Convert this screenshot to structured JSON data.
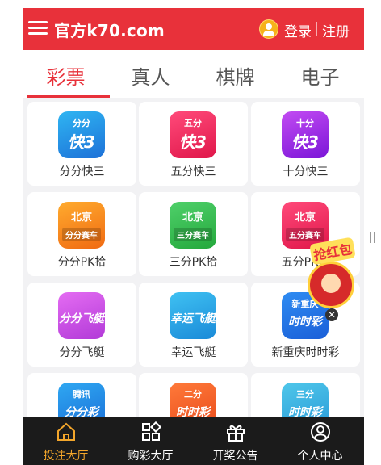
{
  "header": {
    "title": "官方k70.com",
    "login": "登录",
    "separator": "|",
    "register": "注册",
    "bg_color": "#e8313a"
  },
  "tabs": [
    {
      "label": "彩票",
      "active": true
    },
    {
      "label": "真人",
      "active": false
    },
    {
      "label": "棋牌",
      "active": false
    },
    {
      "label": "电子",
      "active": false
    }
  ],
  "games": [
    {
      "label": "分分快三",
      "icon_line1": "分分",
      "icon_line2": "快3",
      "color1": "#2fb5f2",
      "color2": "#1d71d8"
    },
    {
      "label": "五分快三",
      "icon_line1": "五分",
      "icon_line2": "快3",
      "color1": "#ff4a7a",
      "color2": "#e0174a"
    },
    {
      "label": "十分快三",
      "icon_line1": "十分",
      "icon_line2": "快3",
      "color1": "#c24bf2",
      "color2": "#7b16d8"
    },
    {
      "label": "分分PK拾",
      "icon_line1": "北京",
      "icon_line2": "分分赛车",
      "color1": "#ffab2e",
      "color2": "#f06a12"
    },
    {
      "label": "三分PK拾",
      "icon_line1": "北京",
      "icon_line2": "三分赛车",
      "color1": "#4fd06a",
      "color2": "#24a83c"
    },
    {
      "label": "五分PK拾",
      "icon_line1": "北京",
      "icon_line2": "五分赛车",
      "color1": "#ff4a7a",
      "color2": "#e0174a"
    },
    {
      "label": "分分飞艇",
      "icon_line1": "",
      "icon_line2": "分分飞艇",
      "color1": "#e46cf2",
      "color2": "#b23ad8"
    },
    {
      "label": "幸运飞艇",
      "icon_line1": "",
      "icon_line2": "幸运飞艇",
      "color1": "#3fc1f2",
      "color2": "#1a8ad8"
    },
    {
      "label": "新重庆时时彩",
      "icon_line1": "新重庆",
      "icon_line2": "时时彩",
      "color1": "#2f8cf2",
      "color2": "#1a5fd8"
    },
    {
      "label": "",
      "icon_line1": "腾讯",
      "icon_line2": "分分彩",
      "color1": "#2fa8f2",
      "color2": "#1a6fd8"
    },
    {
      "label": "",
      "icon_line1": "二分",
      "icon_line2": "时时彩",
      "color1": "#ff7a3a",
      "color2": "#e84a1a"
    },
    {
      "label": "",
      "icon_line1": "三分",
      "icon_line2": "时时彩",
      "color1": "#4fc7ea",
      "color2": "#2a9bd8"
    }
  ],
  "promo": {
    "text": "抢红包",
    "close": "✕"
  },
  "bottom_nav": [
    {
      "label": "投注大厅",
      "icon": "home-icon",
      "active": true
    },
    {
      "label": "购彩大厅",
      "icon": "grid-icon",
      "active": false
    },
    {
      "label": "开奖公告",
      "icon": "gift-icon",
      "active": false
    },
    {
      "label": "个人中心",
      "icon": "user-icon",
      "active": false
    }
  ]
}
